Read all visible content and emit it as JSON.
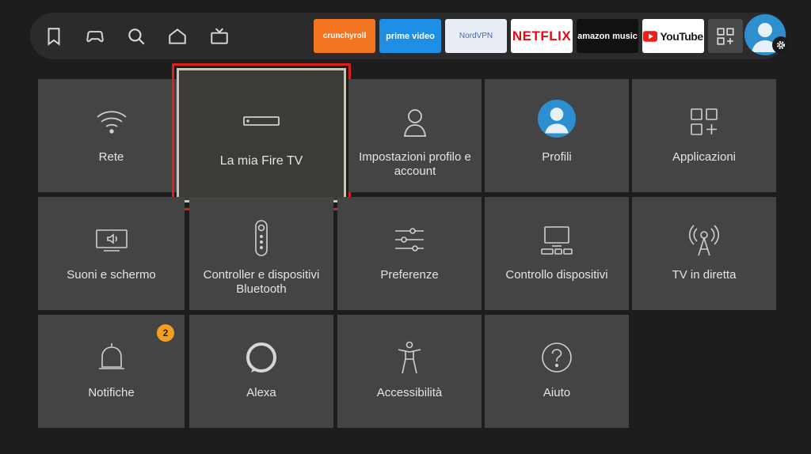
{
  "nav": {
    "icons": [
      "bookmark-icon",
      "gamepad-icon",
      "search-icon",
      "home-icon",
      "live-tv-icon"
    ]
  },
  "apps": [
    {
      "name": "crunchyroll",
      "label": "crunchyroll",
      "bg": "#f47521",
      "fg": "#ffffff"
    },
    {
      "name": "prime-video",
      "label": "prime video",
      "bg": "#1f8fe6",
      "fg": "#ffffff"
    },
    {
      "name": "nordvpn",
      "label": "NordVPN",
      "bg": "#e9eef6",
      "fg": "#4068b0"
    },
    {
      "name": "netflix",
      "label": "NETFLIX",
      "bg": "#ffffff",
      "fg": "#e50914"
    },
    {
      "name": "amazon-music",
      "label": "amazon music",
      "bg": "#111111",
      "fg": "#ffffff"
    },
    {
      "name": "youtube",
      "label": "YouTube",
      "bg": "#ffffff",
      "fg": "#1a1a1a"
    }
  ],
  "tiles": [
    {
      "id": "rete",
      "label": "Rete",
      "icon": "wifi-icon"
    },
    {
      "id": "la-mia-fire-tv",
      "label": "La mia Fire TV",
      "icon": "fire-tv-stick-icon",
      "selected": true
    },
    {
      "id": "impostazioni-profilo",
      "label": "Impostazioni profilo e account",
      "icon": "person-icon"
    },
    {
      "id": "profili",
      "label": "Profili",
      "icon": "profile-avatar-icon"
    },
    {
      "id": "applicazioni",
      "label": "Applicazioni",
      "icon": "apps-icon"
    },
    {
      "id": "suoni-schermo",
      "label": "Suoni e schermo",
      "icon": "display-sound-icon"
    },
    {
      "id": "controller-bluetooth",
      "label": "Controller e dispositivi Bluetooth",
      "icon": "remote-icon"
    },
    {
      "id": "preferenze",
      "label": "Preferenze",
      "icon": "sliders-icon"
    },
    {
      "id": "controllo-dispositivi",
      "label": "Controllo dispositivi",
      "icon": "devices-icon"
    },
    {
      "id": "tv-in-diretta",
      "label": "TV in diretta",
      "icon": "antenna-icon"
    },
    {
      "id": "notifiche",
      "label": "Notifiche",
      "icon": "bell-icon",
      "badge": "2"
    },
    {
      "id": "alexa",
      "label": "Alexa",
      "icon": "alexa-icon"
    },
    {
      "id": "accessibilita",
      "label": "Accessibilità",
      "icon": "accessibility-icon"
    },
    {
      "id": "aiuto",
      "label": "Aiuto",
      "icon": "help-icon"
    }
  ],
  "colors": {
    "background": "#1d1d1d",
    "tile": "#444444",
    "focus": "#e01e1e",
    "badge": "#f3a020"
  }
}
